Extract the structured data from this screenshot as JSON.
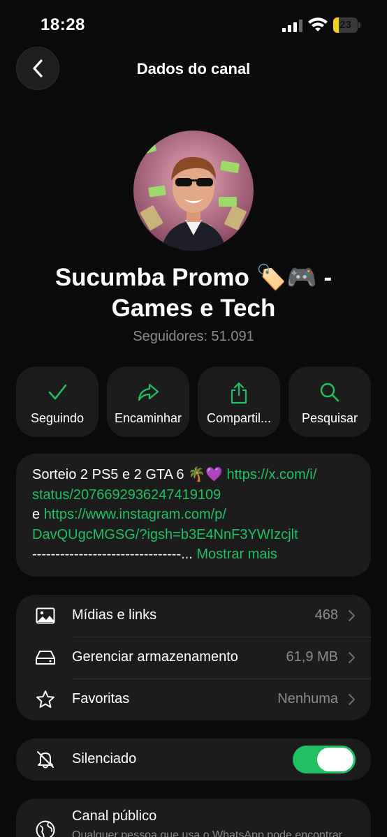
{
  "status_bar": {
    "time": "18:28",
    "battery_level": "23",
    "battery_fraction": 0.23
  },
  "header": {
    "title": "Dados do canal"
  },
  "channel": {
    "name_line1": "Sucumba Promo 🏷️🎮  -",
    "name_line2": "Games e Tech",
    "followers": "Seguidores: 51.091"
  },
  "actions": [
    {
      "label": "Seguindo",
      "icon": "checkmark-icon"
    },
    {
      "label": "Encaminhar",
      "icon": "forward-arrow-icon"
    },
    {
      "label": "Compartil...",
      "icon": "share-icon"
    },
    {
      "label": "Pesquisar",
      "icon": "search-icon"
    }
  ],
  "description": {
    "line1_text": "Sorteio 2 PS5 e 2 GTA 6 🌴💜 ",
    "line1_link": "https://x.com/i/",
    "line2_link": "status/2076692936247419109",
    "line3_text": "e ",
    "line3_link": "https://www.instagram.com/p/",
    "line4_link": "DavQUgcMGSG/?igsh=b3E4NnF3YWIzcjlt",
    "line5_text": "--------------------------------...",
    "show_more": " Mostrar mais"
  },
  "info_rows": [
    {
      "label": "Mídias e links",
      "value": "468",
      "icon": "image-icon"
    },
    {
      "label": "Gerenciar armazenamento",
      "value": "61,9 MB",
      "icon": "storage-icon"
    },
    {
      "label": "Favoritas",
      "value": "Nenhuma",
      "icon": "star-icon"
    }
  ],
  "mute": {
    "label": "Silenciado",
    "enabled": true,
    "icon": "bell-off-icon"
  },
  "public": {
    "title": "Canal público",
    "subtitle": "Qualquer pessoa que usa o WhatsApp pode encontrar",
    "icon": "globe-icon"
  },
  "colors": {
    "accent": "#21c063",
    "background": "#0b0b0b",
    "card": "#1c1c1c",
    "muted_text": "#8c8c8c"
  }
}
